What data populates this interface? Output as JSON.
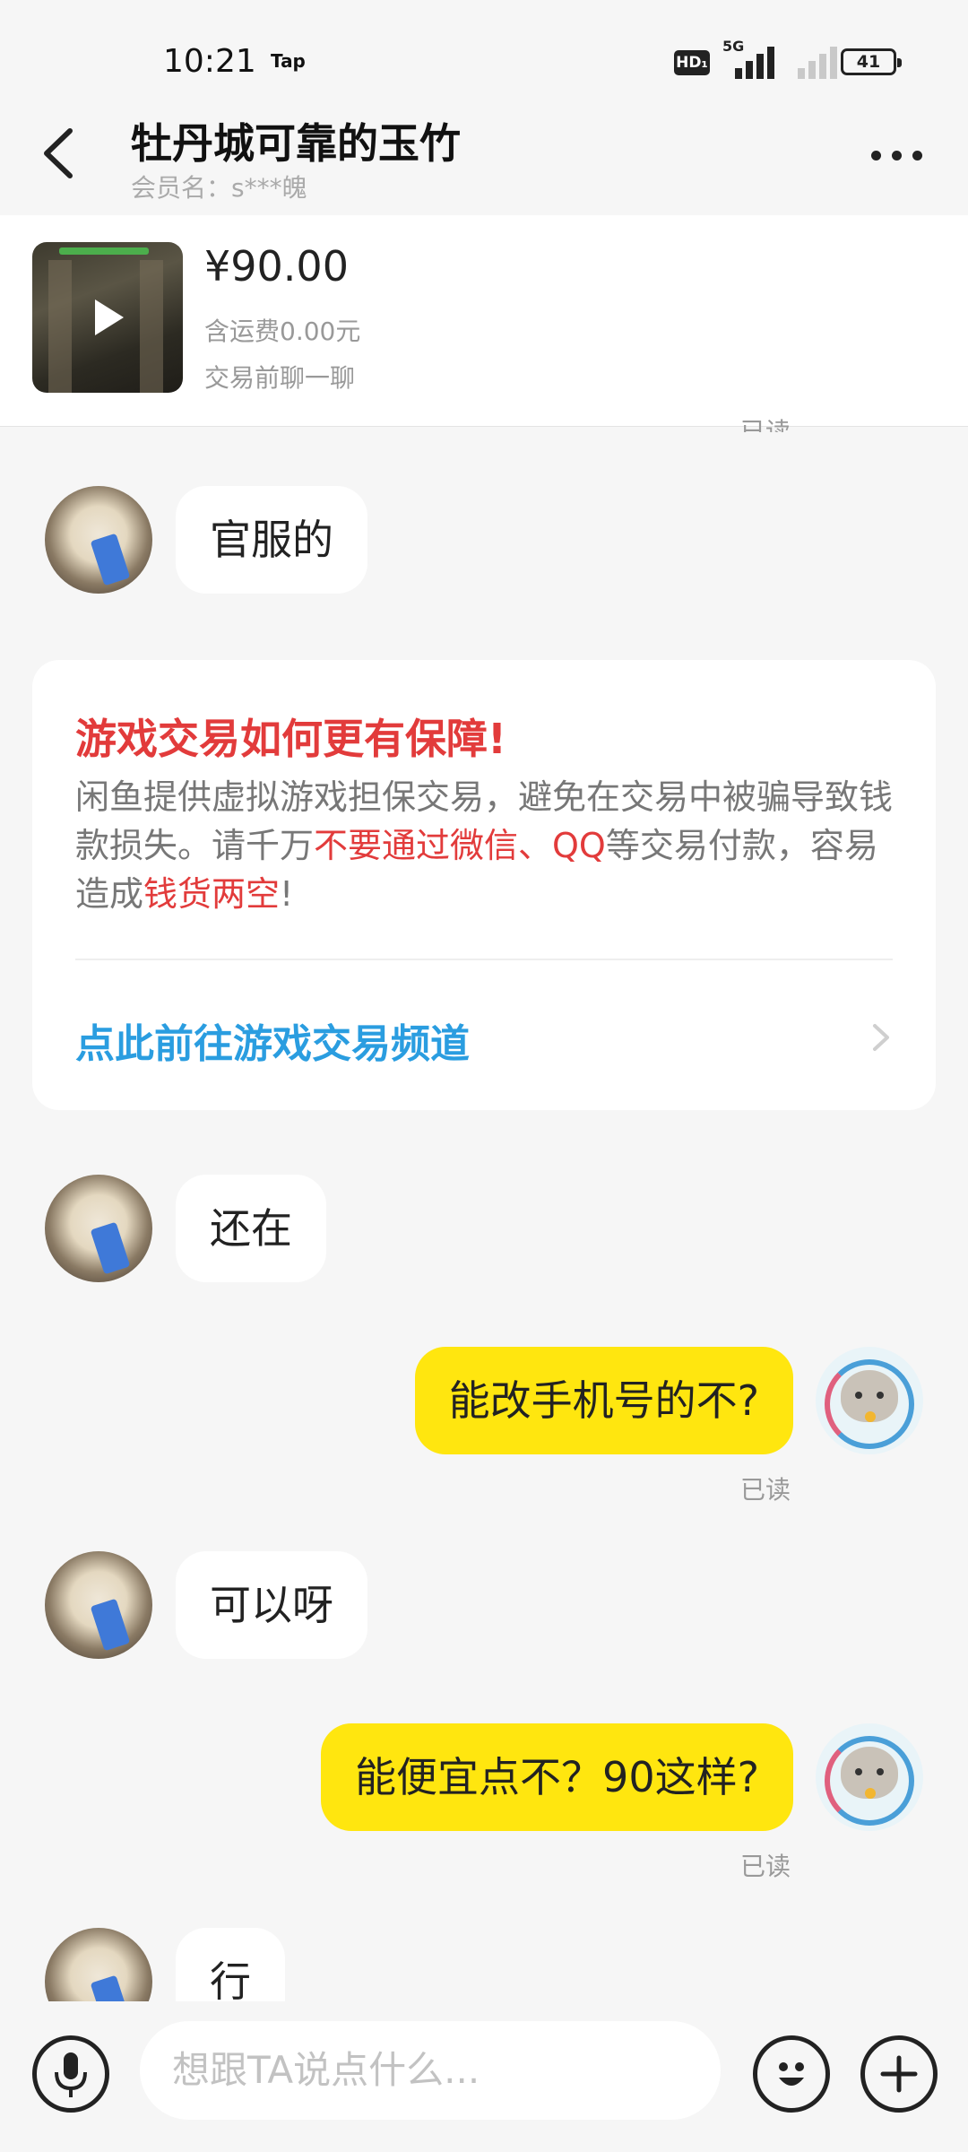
{
  "status_bar": {
    "time": "10:21",
    "tap_label": "Tap",
    "hd_label": "HD₁",
    "network_label": "5G",
    "battery": "41"
  },
  "header": {
    "title": "牡丹城可靠的玉竹",
    "member_name": "会员名：s***魄"
  },
  "product": {
    "price": "¥90.00",
    "shipping": "含运费0.00元",
    "chat_note": "交易前聊一聊"
  },
  "read_label": "已读",
  "messages": [
    {
      "from": "other",
      "text": "官服的"
    },
    {
      "from": "other",
      "text": "还在"
    },
    {
      "from": "me",
      "text": "能改手机号的不?",
      "status": "已读"
    },
    {
      "from": "other",
      "text": "可以呀"
    },
    {
      "from": "me",
      "text": "能便宜点不？90这样?",
      "status": "已读"
    },
    {
      "from": "other",
      "text": "行"
    }
  ],
  "tip_card": {
    "title": "游戏交易如何更有保障!",
    "body_1": "闲鱼提供虚拟游戏担保交易，避免在交易中被骗导致钱款损失。请千万",
    "body_red_1": "不要通过微信、QQ",
    "body_2": "等交易付款，容易造成",
    "body_red_2": "钱货两空",
    "body_3": "!",
    "link": "点此前往游戏交易频道"
  },
  "input_bar": {
    "placeholder": "想跟TA说点什么..."
  },
  "colors": {
    "accent_yellow": "#ffe60f",
    "warning_red": "#e23b3b",
    "link_blue": "#2a9de0"
  }
}
